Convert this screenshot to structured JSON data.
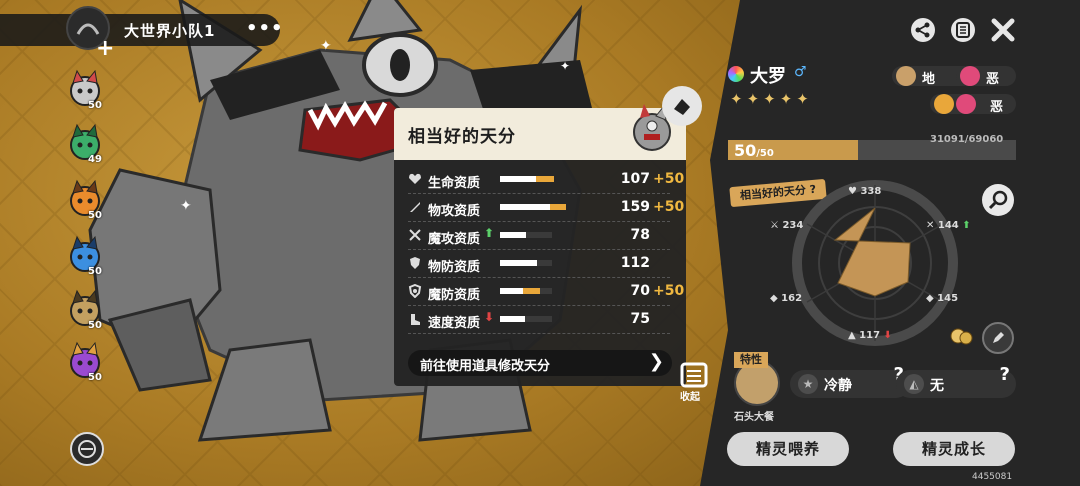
{
  "team": {
    "name": "大世界小队1",
    "more": "•••",
    "add": "+"
  },
  "party": [
    {
      "level": "50",
      "color": "#c9c9c9",
      "accent": "#d14a4a"
    },
    {
      "level": "49",
      "color": "#3cae6a",
      "accent": "#1f6a3c"
    },
    {
      "level": "50",
      "color": "#e98b2c",
      "accent": "#6a3a18"
    },
    {
      "level": "50",
      "color": "#3c8fe0",
      "accent": "#1a3d6a"
    },
    {
      "level": "50",
      "color": "#c3a060",
      "accent": "#4a3a20"
    },
    {
      "level": "50",
      "color": "#9a4ad0",
      "accent": "#e0a040"
    }
  ],
  "talent": {
    "title": "相当好的天分",
    "stats": [
      {
        "label": "生命资质",
        "value": "107",
        "bonus": "+50",
        "icon": "heart-icon",
        "arrow": "",
        "base_pct": 0.7,
        "bonus_pct": 0.33
      },
      {
        "label": "物攻资质",
        "value": "159",
        "bonus": "+50",
        "icon": "sword-icon",
        "arrow": "",
        "base_pct": 0.96,
        "bonus_pct": 0.3
      },
      {
        "label": "魔攻资质",
        "value": "78",
        "bonus": "",
        "icon": "wand-icon",
        "arrow": "⬆",
        "base_pct": 0.5,
        "bonus_pct": 0
      },
      {
        "label": "物防资质",
        "value": "112",
        "bonus": "",
        "icon": "shield-icon",
        "arrow": "",
        "base_pct": 0.72,
        "bonus_pct": 0
      },
      {
        "label": "魔防资质",
        "value": "70",
        "bonus": "+50",
        "icon": "magic-shield-icon",
        "arrow": "",
        "base_pct": 0.45,
        "bonus_pct": 0.32
      },
      {
        "label": "速度资质",
        "value": "75",
        "bonus": "",
        "icon": "boot-icon",
        "arrow": "⬇",
        "base_pct": 0.48,
        "bonus_pct": 0
      }
    ],
    "goto_label": "前往使用道具修改天分",
    "goto_arrow": "❯"
  },
  "pet": {
    "name": "大罗",
    "gender": "♂",
    "stars": "✦✦✦✦✦",
    "types": [
      {
        "label": "地",
        "color": "#c9a06a"
      },
      {
        "label": "恶",
        "color": "#e04a7a"
      }
    ],
    "level": "50",
    "level_max": "/50",
    "level_pct": 0.45,
    "exp": "31091/69060"
  },
  "radar": {
    "tag": "相当好的天分 ?",
    "labels": {
      "hp": "338",
      "patk": "234",
      "matk": "144",
      "pdef": "162",
      "mdef": "145",
      "spd": "117"
    }
  },
  "trait": {
    "badge": "特性",
    "name": "石头大餐"
  },
  "abilities": [
    {
      "label": "冷静",
      "q": "?"
    },
    {
      "label": "无",
      "q": "?"
    }
  ],
  "collapse_label": "收起",
  "buttons": {
    "feed": "精灵喂养",
    "grow": "精灵成长"
  },
  "uid": "4455081",
  "colors": {
    "accent": "#e9a73a",
    "panel": "#262626",
    "gold": "#d9a659"
  }
}
